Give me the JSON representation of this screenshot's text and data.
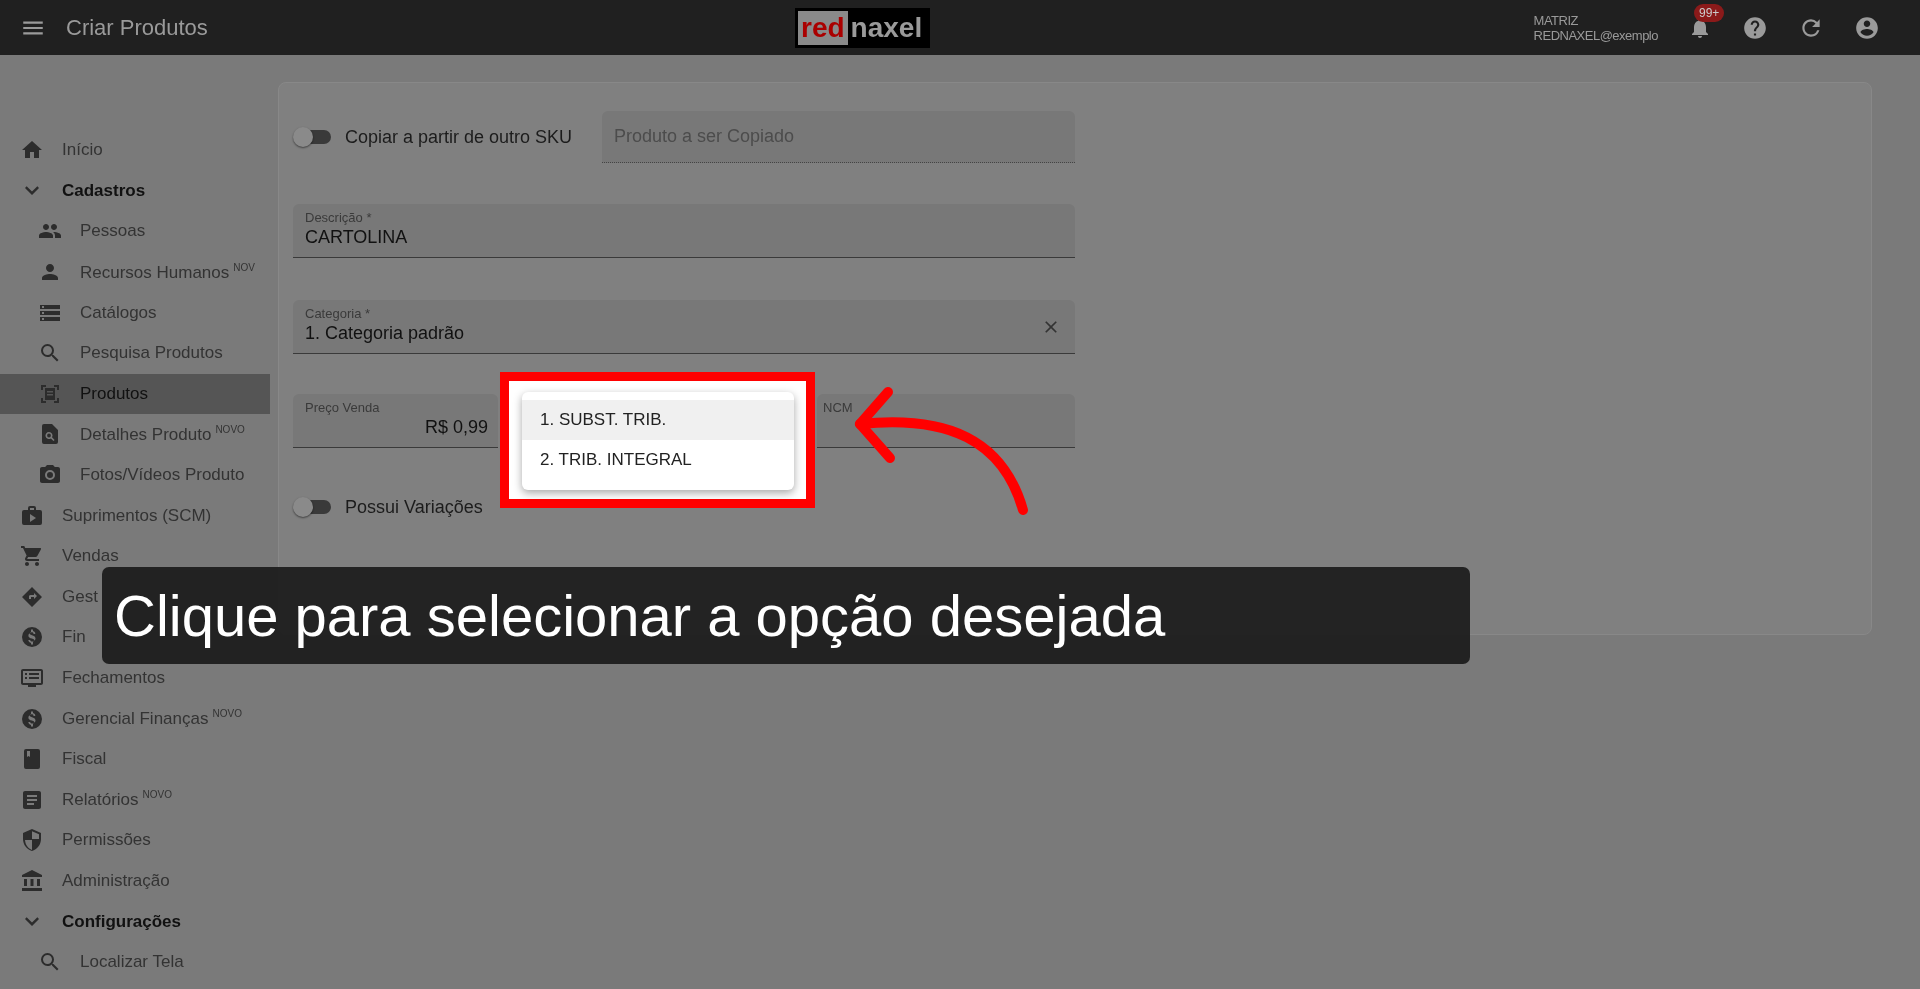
{
  "topbar": {
    "title": "Criar Produtos",
    "logo": {
      "part_1": "red",
      "part_2": "naxel"
    },
    "company": "MATRIZ",
    "user": "REDNAXEL@exemplo",
    "notification_badge": "99+"
  },
  "sidebar": {
    "items": [
      {
        "label": "Início",
        "selected": false
      },
      {
        "label": "Cadastros",
        "selected": false,
        "expanded": true,
        "children": [
          {
            "label": "Pessoas",
            "selected": false
          },
          {
            "label": "Recursos Humanos",
            "badge": "NOV",
            "selected": false
          },
          {
            "label": "Catálogos",
            "selected": false
          },
          {
            "label": "Pesquisa Produtos",
            "selected": false
          },
          {
            "label": "Produtos",
            "selected": true
          },
          {
            "label": "Detalhes Produto",
            "badge": "NOVO",
            "selected": false
          },
          {
            "label": "Fotos/Vídeos Produto",
            "selected": false
          }
        ]
      },
      {
        "label": "Suprimentos (SCM)",
        "selected": false
      },
      {
        "label": "Vendas",
        "selected": false
      },
      {
        "label": "Gest",
        "selected": false
      },
      {
        "label": "Fin",
        "selected": false
      },
      {
        "label": "Fechamentos",
        "selected": false
      },
      {
        "label": "Gerencial Finanças",
        "badge": "NOVO",
        "selected": false
      },
      {
        "label": "Fiscal",
        "selected": false
      },
      {
        "label": "Relatórios",
        "badge": "NOVO",
        "selected": false
      },
      {
        "label": "Permissões",
        "selected": false
      },
      {
        "label": "Administração",
        "selected": false
      },
      {
        "label": "Configurações",
        "selected": false,
        "expanded": true,
        "children": [
          {
            "label": "Localizar Tela",
            "selected": false
          }
        ]
      }
    ]
  },
  "form": {
    "copy_toggle": {
      "label": "Copiar a partir de outro SKU",
      "on": false
    },
    "copy_field": {
      "placeholder": "Produto a ser Copiado"
    },
    "description": {
      "label": "Descrição *",
      "value": "CARTOLINA"
    },
    "category": {
      "label": "Categoria *",
      "value": "1. Categoria padrão"
    },
    "price": {
      "label": "Preço Venda",
      "value": "R$ 0,99"
    },
    "ncm": {
      "label": "NCM"
    },
    "variations_toggle": {
      "label": "Possui Variações",
      "on": false
    }
  },
  "dropdown": {
    "options": [
      {
        "label": "1. SUBST. TRIB.",
        "selected": true
      },
      {
        "label": "2. TRIB. INTEGRAL",
        "selected": false
      }
    ]
  },
  "caption": "Clique para selecionar a opção desejada"
}
